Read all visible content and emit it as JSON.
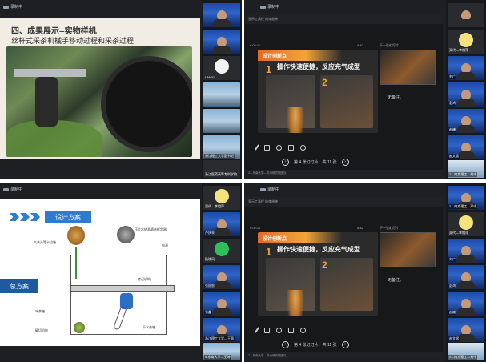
{
  "meeting": {
    "status_label": "录制中"
  },
  "q1": {
    "slide_title": "四、成果展示--实物样机",
    "slide_subtitle": "丝杆式采茶机械手移动过程和采茶过程",
    "participants": [
      {
        "name": "",
        "kind": "banner"
      },
      {
        "name": "",
        "kind": "banner"
      },
      {
        "name": "LANXI",
        "kind": "avatar-white"
      },
      {
        "name": "",
        "kind": "office"
      },
      {
        "name": "",
        "kind": "office"
      },
      {
        "name": "浙江理工大学彭书记",
        "kind": "plain"
      },
      {
        "name": "浙江医药高等专科学校",
        "kind": "plain"
      }
    ]
  },
  "q2": {
    "topbar": "显示工具栏   结束放映",
    "clock": "0:02:11",
    "timer": "4:42",
    "next_label": "下一张幻灯片",
    "slide_header": "设计创新点",
    "slide_num1": "1",
    "slide_num2": "2",
    "slide_big": "操作快速便捷，反应充气成型",
    "notes": "无备注。",
    "pager": "第 4 张幻灯片，共 11 张",
    "bottom": "2—东南大学—苏州研究院团队",
    "participants": [
      {
        "name": "",
        "kind": "face"
      },
      {
        "name": "双代—李相萍",
        "kind": "avatar-yellow"
      },
      {
        "name": "刘广",
        "kind": "banner"
      },
      {
        "name": "彭鸿",
        "kind": "banner"
      },
      {
        "name": "赵巍",
        "kind": "banner"
      },
      {
        "name": "赵文斌",
        "kind": "banner"
      },
      {
        "name": "2—南京理工—刘中",
        "kind": "office"
      }
    ]
  },
  "q3": {
    "design_title": "设计方案",
    "summary_label": "总方案",
    "labels": {
      "l1": "大茶头等卡拉箱",
      "l2": "压片水结晶筛选框定器",
      "l3": "电源",
      "l4": "叶茶箱",
      "l5": "传送机构",
      "l6": "碾切机构",
      "l7": "干水茶箱"
    },
    "participants": [
      {
        "name": "双代—李相萍",
        "kind": "avatar-yellow"
      },
      {
        "name": "芦庆荣",
        "kind": "banner"
      },
      {
        "name": "陆晓风",
        "kind": "avatar-green"
      },
      {
        "name": "张国智",
        "kind": "banner"
      },
      {
        "name": "张鑫",
        "kind": "banner"
      },
      {
        "name": "浙江理工大学—王雨",
        "kind": "banner"
      },
      {
        "name": "4-东南大学—王坤",
        "kind": "office"
      }
    ]
  },
  "q4": {
    "topbar": "显示工具栏   结束放映",
    "clock": "0:02:11",
    "timer": "4:42",
    "next_label": "下一张幻灯片",
    "slide_header": "设计创新点",
    "slide_num1": "1",
    "slide_num2": "2",
    "slide_big": "操作快速便捷，反应充气成型",
    "notes": "无备注。",
    "pager": "第 4 张幻灯片，共 11 张",
    "bottom": "2—东南大学—苏州研究院团队",
    "participants": [
      {
        "name": "2—南京理工—邓中",
        "kind": "face"
      },
      {
        "name": "双代—李相萍",
        "kind": "avatar-yellow"
      },
      {
        "name": "刘广",
        "kind": "banner"
      },
      {
        "name": "彭鸿",
        "kind": "banner"
      },
      {
        "name": "赵巍",
        "kind": "banner"
      },
      {
        "name": "赵文斌",
        "kind": "banner"
      },
      {
        "name": "2—南京理工—刘中",
        "kind": "office"
      }
    ]
  }
}
